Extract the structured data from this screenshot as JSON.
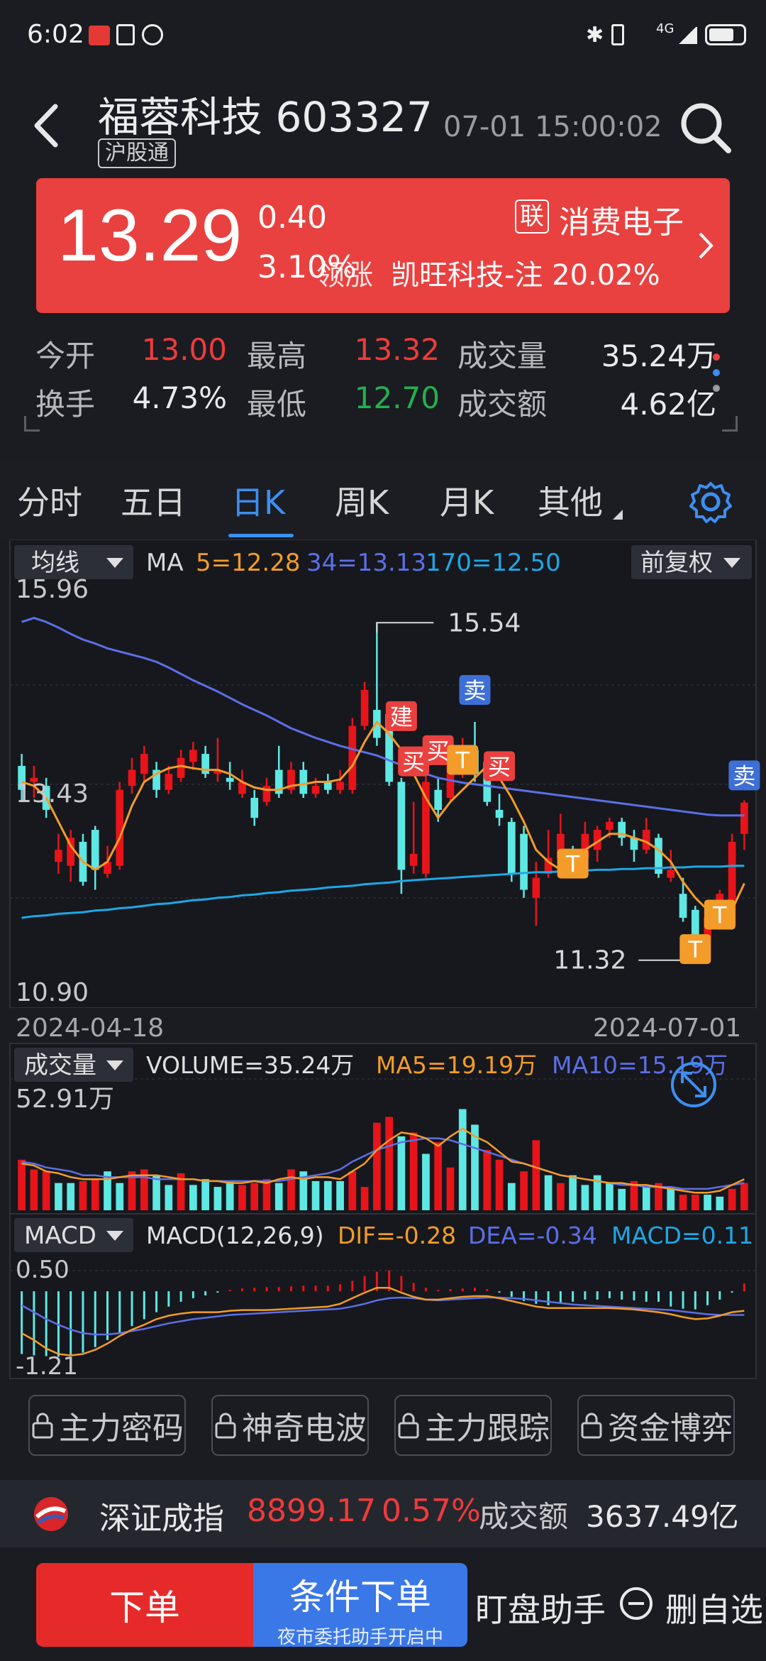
{
  "status_bar": {
    "time": "6:02",
    "network": "4G"
  },
  "header": {
    "stock_name": "福蓉科技",
    "stock_code": "603327",
    "tag": "沪股通",
    "datetime": "07-01 15:00:02"
  },
  "price_box": {
    "price": "13.29",
    "change": "0.40",
    "change_pct": "3.10%",
    "lian_badge": "联",
    "sector": "消费电子",
    "overlay_word": "领涨",
    "ticker_text": "凯旺科技-注 20.02%"
  },
  "stats": {
    "open_label": "今开",
    "open_value": "13.00",
    "high_label": "最高",
    "high_value": "13.32",
    "volume_label": "成交量",
    "volume_value": "35.24万",
    "turnover_label": "换手",
    "turnover_value": "4.73%",
    "low_label": "最低",
    "low_value": "12.70",
    "amount_label": "成交额",
    "amount_value": "4.62亿"
  },
  "tabs": [
    "分时",
    "五日",
    "日K",
    "周K",
    "月K",
    "其他"
  ],
  "active_tab": "日K",
  "colors": {
    "up": "#e8141a",
    "down": "#5ee8e4",
    "ma5": "#f39c29",
    "ma34": "#5c6fe6",
    "ma170": "#1ea8e6",
    "accent": "#3d8ff0",
    "price_box": "#e9413f"
  },
  "chart_data": [
    {
      "type": "candlestick",
      "indicator_selector": "均线",
      "adjust_selector": "前复权",
      "legend": {
        "ma_label": "MA",
        "ma5": "5=12.28",
        "ma34": "34=13.13",
        "ma170": "170=12.50"
      },
      "y_top_label": "15.96",
      "y_mid_label": "13.43",
      "y_bottom_label": "10.90",
      "ylim": [
        10.9,
        15.96
      ],
      "max_label": "15.54",
      "min_label": "11.32",
      "x_start": "2024-04-18",
      "x_end": "2024-07-01",
      "annotations": [
        "建",
        "买",
        "买",
        "卖",
        "买",
        "T",
        "T",
        "T",
        "T",
        "卖"
      ],
      "candles": [
        {
          "o": 13.75,
          "c": 13.45,
          "h": 13.9,
          "l": 13.3
        },
        {
          "o": 13.55,
          "c": 13.6,
          "h": 13.75,
          "l": 13.35
        },
        {
          "o": 13.5,
          "c": 13.2,
          "h": 13.6,
          "l": 13.1
        },
        {
          "o": 12.55,
          "c": 12.7,
          "h": 12.9,
          "l": 12.4
        },
        {
          "o": 12.5,
          "c": 12.85,
          "h": 12.95,
          "l": 12.3
        },
        {
          "o": 12.8,
          "c": 12.3,
          "h": 12.9,
          "l": 12.25
        },
        {
          "o": 12.95,
          "c": 12.45,
          "h": 13.0,
          "l": 12.2
        },
        {
          "o": 12.4,
          "c": 12.55,
          "h": 12.75,
          "l": 12.35
        },
        {
          "o": 12.5,
          "c": 13.45,
          "h": 13.55,
          "l": 12.45
        },
        {
          "o": 13.5,
          "c": 13.7,
          "h": 13.85,
          "l": 13.4
        },
        {
          "o": 13.65,
          "c": 13.9,
          "h": 14.0,
          "l": 13.55
        },
        {
          "o": 13.7,
          "c": 13.45,
          "h": 13.8,
          "l": 13.35
        },
        {
          "o": 13.45,
          "c": 13.65,
          "h": 13.75,
          "l": 13.4
        },
        {
          "o": 13.6,
          "c": 13.85,
          "h": 13.95,
          "l": 13.55
        },
        {
          "o": 13.8,
          "c": 13.95,
          "h": 14.05,
          "l": 13.7
        },
        {
          "o": 13.9,
          "c": 13.65,
          "h": 14.0,
          "l": 13.6
        },
        {
          "o": 13.65,
          "c": 13.7,
          "h": 14.1,
          "l": 13.55
        },
        {
          "o": 13.6,
          "c": 13.55,
          "h": 13.8,
          "l": 13.45
        },
        {
          "o": 13.4,
          "c": 13.55,
          "h": 13.7,
          "l": 13.35
        },
        {
          "o": 13.35,
          "c": 13.1,
          "h": 13.45,
          "l": 13.0
        },
        {
          "o": 13.3,
          "c": 13.5,
          "h": 13.6,
          "l": 13.25
        },
        {
          "o": 13.7,
          "c": 13.4,
          "h": 14.0,
          "l": 13.35
        },
        {
          "o": 13.45,
          "c": 13.7,
          "h": 13.8,
          "l": 13.4
        },
        {
          "o": 13.7,
          "c": 13.4,
          "h": 13.8,
          "l": 13.35
        },
        {
          "o": 13.4,
          "c": 13.5,
          "h": 13.6,
          "l": 13.35
        },
        {
          "o": 13.55,
          "c": 13.45,
          "h": 13.65,
          "l": 13.4
        },
        {
          "o": 13.45,
          "c": 13.55,
          "h": 13.7,
          "l": 13.4
        },
        {
          "o": 13.45,
          "c": 14.25,
          "h": 14.35,
          "l": 13.4
        },
        {
          "o": 14.25,
          "c": 14.7,
          "h": 14.8,
          "l": 14.2
        },
        {
          "o": 14.45,
          "c": 14.1,
          "h": 15.54,
          "l": 14.0
        },
        {
          "o": 14.4,
          "c": 13.55,
          "h": 14.45,
          "l": 13.5
        },
        {
          "o": 13.55,
          "c": 12.45,
          "h": 13.6,
          "l": 12.15
        },
        {
          "o": 12.5,
          "c": 12.65,
          "h": 13.3,
          "l": 12.4
        },
        {
          "o": 12.4,
          "c": 13.55,
          "h": 13.7,
          "l": 12.35
        },
        {
          "o": 13.45,
          "c": 13.2,
          "h": 13.6,
          "l": 13.05
        },
        {
          "o": 13.35,
          "c": 13.75,
          "h": 13.85,
          "l": 13.3
        },
        {
          "o": 13.75,
          "c": 14.0,
          "h": 14.1,
          "l": 13.6
        },
        {
          "o": 13.95,
          "c": 13.65,
          "h": 14.3,
          "l": 13.55
        },
        {
          "o": 13.8,
          "c": 13.3,
          "h": 13.85,
          "l": 13.25
        },
        {
          "o": 13.2,
          "c": 13.1,
          "h": 13.4,
          "l": 13.0
        },
        {
          "o": 13.05,
          "c": 12.4,
          "h": 13.1,
          "l": 12.3
        },
        {
          "o": 12.9,
          "c": 12.2,
          "h": 13.0,
          "l": 12.1
        },
        {
          "o": 12.1,
          "c": 12.35,
          "h": 12.55,
          "l": 11.75
        },
        {
          "o": 12.4,
          "c": 12.6,
          "h": 12.95,
          "l": 12.35
        },
        {
          "o": 12.6,
          "c": 12.9,
          "h": 13.15,
          "l": 12.55
        },
        {
          "o": 12.6,
          "c": 12.55,
          "h": 12.75,
          "l": 12.45
        },
        {
          "o": 12.6,
          "c": 12.9,
          "h": 13.05,
          "l": 12.55
        },
        {
          "o": 12.7,
          "c": 12.95,
          "h": 13.0,
          "l": 12.55
        },
        {
          "o": 12.95,
          "c": 13.05,
          "h": 13.1,
          "l": 12.85
        },
        {
          "o": 13.05,
          "c": 12.85,
          "h": 13.1,
          "l": 12.75
        },
        {
          "o": 12.85,
          "c": 12.7,
          "h": 12.95,
          "l": 12.55
        },
        {
          "o": 12.7,
          "c": 12.95,
          "h": 13.1,
          "l": 12.65
        },
        {
          "o": 12.85,
          "c": 12.4,
          "h": 12.9,
          "l": 12.35
        },
        {
          "o": 12.35,
          "c": 12.45,
          "h": 12.7,
          "l": 12.3
        },
        {
          "o": 12.15,
          "c": 11.85,
          "h": 12.35,
          "l": 11.8
        },
        {
          "o": 11.95,
          "c": 11.55,
          "h": 12.0,
          "l": 11.32
        },
        {
          "o": 11.6,
          "c": 11.85,
          "h": 11.95,
          "l": 11.5
        },
        {
          "o": 11.75,
          "c": 12.15,
          "h": 12.2,
          "l": 11.7
        },
        {
          "o": 11.75,
          "c": 12.8,
          "h": 12.9,
          "l": 11.7
        },
        {
          "o": 12.9,
          "c": 13.29,
          "h": 13.32,
          "l": 12.7
        }
      ],
      "ma5": [
        13.55,
        13.5,
        13.35,
        13.05,
        12.75,
        12.55,
        12.45,
        12.55,
        12.85,
        13.25,
        13.55,
        13.65,
        13.72,
        13.75,
        13.72,
        13.7,
        13.7,
        13.65,
        13.55,
        13.48,
        13.45,
        13.45,
        13.5,
        13.52,
        13.55,
        13.55,
        13.58,
        13.75,
        14.05,
        14.3,
        14.15,
        13.95,
        13.65,
        13.35,
        13.1,
        13.3,
        13.45,
        13.6,
        13.75,
        13.6,
        13.35,
        13.05,
        12.7,
        12.55,
        12.45,
        12.55,
        12.7,
        12.8,
        12.9,
        12.9,
        12.85,
        12.8,
        12.7,
        12.55,
        12.3,
        12.1,
        11.95,
        11.85,
        11.95,
        12.28
      ],
      "ma34": [
        15.55,
        15.6,
        15.55,
        15.48,
        15.4,
        15.33,
        15.28,
        15.22,
        15.18,
        15.14,
        15.1,
        15.05,
        14.98,
        14.9,
        14.82,
        14.75,
        14.68,
        14.6,
        14.52,
        14.45,
        14.38,
        14.3,
        14.22,
        14.16,
        14.1,
        14.05,
        14.0,
        13.96,
        13.92,
        13.88,
        13.82,
        13.76,
        13.7,
        13.65,
        13.6,
        13.57,
        13.54,
        13.52,
        13.5,
        13.48,
        13.46,
        13.44,
        13.42,
        13.4,
        13.38,
        13.36,
        13.34,
        13.32,
        13.3,
        13.28,
        13.26,
        13.24,
        13.22,
        13.2,
        13.18,
        13.16,
        13.14,
        13.13,
        13.13,
        13.13
      ],
      "ma170": [
        11.85,
        11.87,
        11.88,
        11.9,
        11.91,
        11.92,
        11.94,
        11.95,
        11.97,
        11.98,
        12.0,
        12.02,
        12.03,
        12.05,
        12.07,
        12.08,
        12.1,
        12.11,
        12.13,
        12.14,
        12.16,
        12.17,
        12.19,
        12.2,
        12.21,
        12.23,
        12.24,
        12.25,
        12.27,
        12.28,
        12.29,
        12.31,
        12.32,
        12.33,
        12.34,
        12.35,
        12.36,
        12.37,
        12.38,
        12.39,
        12.4,
        12.41,
        12.42,
        12.42,
        12.43,
        12.44,
        12.44,
        12.45,
        12.45,
        12.46,
        12.46,
        12.47,
        12.47,
        12.48,
        12.48,
        12.49,
        12.49,
        12.49,
        12.5,
        12.5
      ]
    },
    {
      "type": "bar",
      "indicator_selector": "成交量",
      "legend": {
        "volume": "VOLUME=35.24万",
        "ma5": "MA5=19.19万",
        "ma10": "MA10=15.19万"
      },
      "y_top_label": "52.91万",
      "ylim": [
        0,
        52.91
      ],
      "unit": "万",
      "values": [
        26,
        21,
        20,
        14,
        14,
        15,
        16,
        20,
        14,
        20,
        21,
        18,
        13,
        19,
        13,
        16,
        12,
        15,
        13,
        14,
        16,
        14,
        21,
        20,
        15,
        15,
        15,
        20,
        12,
        45,
        48,
        38,
        40,
        29,
        35,
        22,
        52,
        44,
        31,
        26,
        14,
        20,
        36,
        18,
        14,
        18,
        13,
        18,
        14,
        11,
        15,
        12,
        14,
        12,
        8,
        8,
        8,
        7,
        11,
        14,
        28,
        35.24
      ],
      "up": [
        1,
        1,
        1,
        0,
        0,
        1,
        1,
        0,
        0,
        1,
        1,
        0,
        0,
        1,
        0,
        0,
        0,
        0,
        1,
        1,
        1,
        0,
        1,
        0,
        0,
        0,
        0,
        1,
        1,
        1,
        1,
        0,
        1,
        0,
        1,
        1,
        0,
        0,
        1,
        1,
        0,
        1,
        1,
        0,
        1,
        0,
        0,
        0,
        0,
        0,
        1,
        0,
        1,
        0,
        1,
        1,
        0,
        0,
        1,
        1,
        1,
        1
      ],
      "ma5": [
        24,
        23,
        20,
        19,
        17,
        16,
        16,
        16,
        17,
        18,
        18,
        18,
        17,
        16,
        16,
        15,
        15,
        14,
        14,
        15,
        14,
        16,
        17,
        16,
        17,
        17,
        16,
        20,
        24,
        31,
        36,
        40,
        39,
        37,
        33,
        38,
        42,
        38,
        35,
        30,
        25,
        24,
        22,
        20,
        18,
        17,
        16,
        15,
        14,
        14,
        13,
        13,
        12,
        11,
        10,
        9,
        9,
        10,
        13,
        16,
        19,
        19.19
      ],
      "ma10": [
        25,
        24,
        22,
        21,
        20,
        18,
        18,
        17,
        17,
        17,
        17,
        16,
        16,
        16,
        16,
        15,
        15,
        15,
        15,
        15,
        15,
        15,
        16,
        17,
        18,
        19,
        21,
        25,
        28,
        31,
        33,
        35,
        36,
        37,
        37,
        36,
        34,
        32,
        30,
        28,
        26,
        24,
        22,
        20,
        18,
        17,
        16,
        15,
        14,
        13,
        13,
        12,
        12,
        12,
        11,
        11,
        11,
        12,
        13,
        14,
        15,
        15.19
      ]
    },
    {
      "type": "bar",
      "indicator_selector": "MACD",
      "legend": {
        "params": "MACD(12,26,9)",
        "dif": "DIF=-0.28",
        "dea": "DEA=-0.34",
        "macd": "MACD=0.11"
      },
      "y_top_label": "0.50",
      "y_bottom_label": "-1.21",
      "ylim": [
        -1.21,
        0.5
      ],
      "hist": [
        -0.9,
        -0.92,
        -0.93,
        -0.94,
        -0.92,
        -0.88,
        -0.8,
        -0.7,
        -0.6,
        -0.5,
        -0.4,
        -0.3,
        -0.22,
        -0.15,
        -0.1,
        -0.06,
        -0.02,
        0.02,
        0.04,
        0.05,
        0.06,
        0.06,
        0.07,
        0.08,
        0.08,
        0.08,
        0.1,
        0.15,
        0.22,
        0.28,
        0.3,
        0.22,
        0.12,
        0.05,
        0.02,
        0.03,
        0.04,
        0.05,
        0.03,
        -0.02,
        -0.08,
        -0.14,
        -0.18,
        -0.2,
        -0.18,
        -0.15,
        -0.12,
        -0.12,
        -0.1,
        -0.12,
        -0.13,
        -0.15,
        -0.15,
        -0.22,
        -0.25,
        -0.26,
        -0.2,
        -0.12,
        -0.02,
        0.11
      ],
      "dif": [
        -0.6,
        -0.7,
        -0.82,
        -0.9,
        -0.92,
        -0.9,
        -0.84,
        -0.75,
        -0.64,
        -0.55,
        -0.48,
        -0.4,
        -0.35,
        -0.32,
        -0.3,
        -0.3,
        -0.3,
        -0.28,
        -0.27,
        -0.27,
        -0.27,
        -0.26,
        -0.25,
        -0.24,
        -0.23,
        -0.22,
        -0.18,
        -0.1,
        -0.02,
        0.05,
        0.05,
        -0.02,
        -0.08,
        -0.12,
        -0.12,
        -0.1,
        -0.08,
        -0.07,
        -0.07,
        -0.1,
        -0.14,
        -0.18,
        -0.22,
        -0.24,
        -0.24,
        -0.24,
        -0.24,
        -0.24,
        -0.24,
        -0.25,
        -0.26,
        -0.28,
        -0.3,
        -0.33,
        -0.37,
        -0.4,
        -0.39,
        -0.35,
        -0.3,
        -0.28
      ],
      "dea": [
        -0.2,
        -0.3,
        -0.4,
        -0.48,
        -0.55,
        -0.6,
        -0.62,
        -0.62,
        -0.6,
        -0.57,
        -0.54,
        -0.5,
        -0.46,
        -0.43,
        -0.4,
        -0.38,
        -0.36,
        -0.34,
        -0.33,
        -0.32,
        -0.31,
        -0.3,
        -0.29,
        -0.28,
        -0.27,
        -0.26,
        -0.25,
        -0.22,
        -0.18,
        -0.13,
        -0.1,
        -0.09,
        -0.1,
        -0.12,
        -0.13,
        -0.12,
        -0.11,
        -0.1,
        -0.09,
        -0.09,
        -0.1,
        -0.11,
        -0.13,
        -0.15,
        -0.17,
        -0.19,
        -0.2,
        -0.21,
        -0.22,
        -0.23,
        -0.24,
        -0.25,
        -0.26,
        -0.27,
        -0.29,
        -0.31,
        -0.33,
        -0.34,
        -0.34,
        -0.34
      ]
    }
  ],
  "locked_features": [
    "主力密码",
    "神奇电波",
    "主力跟踪",
    "资金博弈"
  ],
  "index_bar": {
    "name": "深证成指",
    "value": "8899.17",
    "change_pct": "0.57%",
    "amount_label": "成交额",
    "amount": "3637.49亿"
  },
  "actions": {
    "order": "下单",
    "conditional_order": "条件下单",
    "conditional_sub": "夜市委托助手开启中",
    "monitor": "盯盘助手",
    "remove_watch": "删自选"
  }
}
